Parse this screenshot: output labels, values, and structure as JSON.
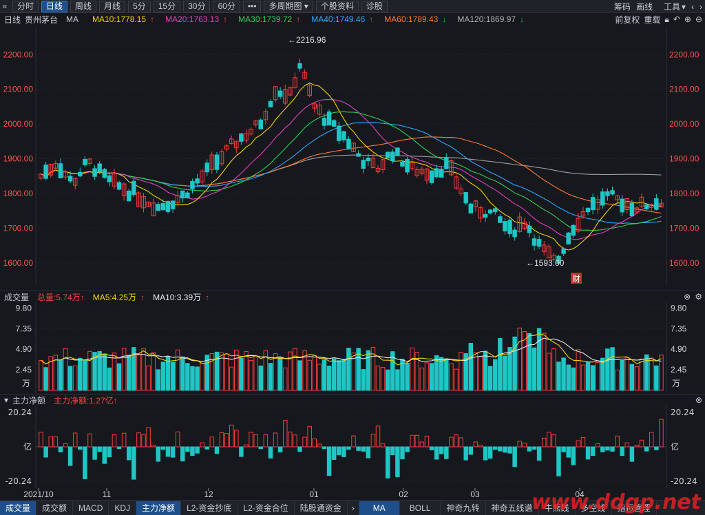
{
  "toolbar": {
    "back_glyph": "«",
    "periods": [
      "分时",
      "日线",
      "周线",
      "月线",
      "5分",
      "15分",
      "30分",
      "60分"
    ],
    "active_period": 1,
    "more_label": "•••",
    "multi_period_label": "多周期图",
    "stock_info_label": "个股资料",
    "diagnose_label": "诊股",
    "right_items": [
      "筹码",
      "画线",
      "工具"
    ]
  },
  "info": {
    "period": "日线",
    "stock_name": "贵州茅台",
    "indicator": "MA",
    "ma": [
      {
        "label": "MA10:1778.15",
        "color": "#f5d300",
        "arrow": "↑",
        "arrow_color": "#ff4040"
      },
      {
        "label": "MA20:1763.13",
        "color": "#e040c0",
        "arrow": "↑",
        "arrow_color": "#ff4040"
      },
      {
        "label": "MA30:1739.72",
        "color": "#30d050",
        "arrow": "↑",
        "arrow_color": "#ff4040"
      },
      {
        "label": "MA40:1749.46",
        "color": "#2aa8ff",
        "arrow": "↑",
        "arrow_color": "#ff4040"
      },
      {
        "label": "MA60:1789.43",
        "color": "#ff7a30",
        "arrow": "↓",
        "arrow_color": "#20c050"
      },
      {
        "label": "MA120:1869.97",
        "color": "#b0b0b0",
        "arrow": "↓",
        "arrow_color": "#20c050"
      }
    ],
    "right": [
      "前复权",
      "重载"
    ]
  },
  "price_axis": {
    "ticks": [
      "2200.00",
      "2100.00",
      "2000.00",
      "1900.00",
      "1800.00",
      "1700.00",
      "1600.00"
    ],
    "high_label": "←2216.96",
    "low_label": "←1593.00",
    "finance_badge": "财"
  },
  "volume": {
    "title": "成交量",
    "total": "总量:5.74万",
    "ma5": "MA5:4.25万",
    "ma10": "MA10:3.39万",
    "ticks": [
      "9.80",
      "7.35",
      "4.90",
      "2.45"
    ],
    "unit": "万"
  },
  "fund": {
    "title": "主力净额",
    "value": "主力净额:1.27亿",
    "ticks": [
      "20.24",
      "亿",
      "-20.24"
    ]
  },
  "time_axis": [
    "2021/10",
    "11",
    "12",
    "01",
    "02",
    "03",
    "04"
  ],
  "bottom_tabs_left": [
    "成交量",
    "成交额",
    "MACD",
    "KDJ",
    "主力净额",
    "L2-资金抄底",
    "L2-资金合位",
    "陆股通资金"
  ],
  "bottom_tabs_right": [
    "MA",
    "BOLL",
    "神奇九转",
    "神奇五线谱",
    "牛熊线",
    "多空线",
    "指标管理"
  ],
  "watermark": "www.ddgp.net",
  "colors": {
    "up": "#ff3b3b",
    "down": "#1fc6c6",
    "background": "#16181d"
  }
}
